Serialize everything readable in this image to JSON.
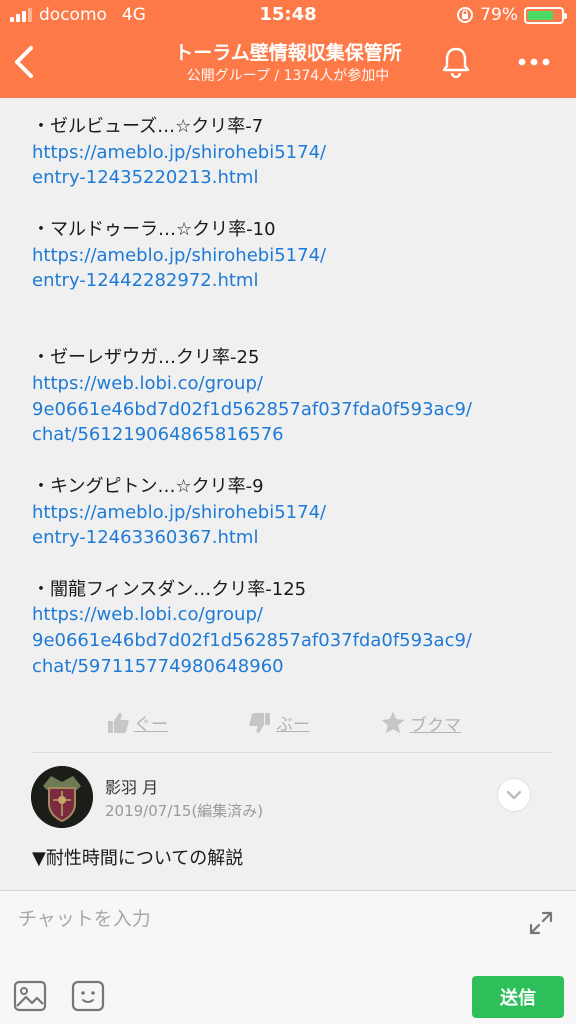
{
  "status_bar": {
    "carrier": "docomo",
    "network": "4G",
    "time": "15:48",
    "battery": "79%",
    "battery_level": 0.79,
    "battery_color": "#4cd964"
  },
  "nav": {
    "title": "トーラム壁情報収集保管所",
    "subtitle": "公開グループ / 1374人が参加中",
    "back_icon": "chevron-left-icon",
    "bell_icon": "bell-icon",
    "more_icon": "more-dots-icon",
    "bg_color": "#fd7a48"
  },
  "post": {
    "entries": [
      {
        "name": "・ゼルビューズ…☆クリ率-7",
        "url_lines": [
          "https://ameblo.jp/shirohebi5174/",
          "entry-12435220213.html"
        ]
      },
      {
        "name": "・マルドゥーラ…☆クリ率-10",
        "url_lines": [
          "https://ameblo.jp/shirohebi5174/",
          "entry-12442282972.html"
        ]
      },
      {
        "name": "・ゼーレザウガ…クリ率-25",
        "url_lines": [
          "https://web.lobi.co/group/",
          "9e0661e46bd7d02f1d562857af037fda0f593ac9/",
          "chat/561219064865816576"
        ]
      },
      {
        "name": "・キングピトン…☆クリ率-9",
        "url_lines": [
          "https://ameblo.jp/shirohebi5174/",
          "entry-12463360367.html"
        ]
      },
      {
        "name": "・闇龍フィンスダン…クリ率-125",
        "url_lines": [
          "https://web.lobi.co/group/",
          "9e0661e46bd7d02f1d562857af037fda0f593ac9/",
          "chat/597115774980648960"
        ]
      }
    ],
    "link_color": "#1d7ad6"
  },
  "reactions": {
    "like_label": "ぐー",
    "dislike_label": "ぶー",
    "bookmark_label": "ブクマ"
  },
  "comment": {
    "author": "影羽 月",
    "date": "2019/07/15(編集済み)",
    "body": "▼耐性時間についての解説"
  },
  "input_bar": {
    "placeholder": "チャットを入力",
    "send_label": "送信",
    "send_color": "#2fbf5a"
  }
}
